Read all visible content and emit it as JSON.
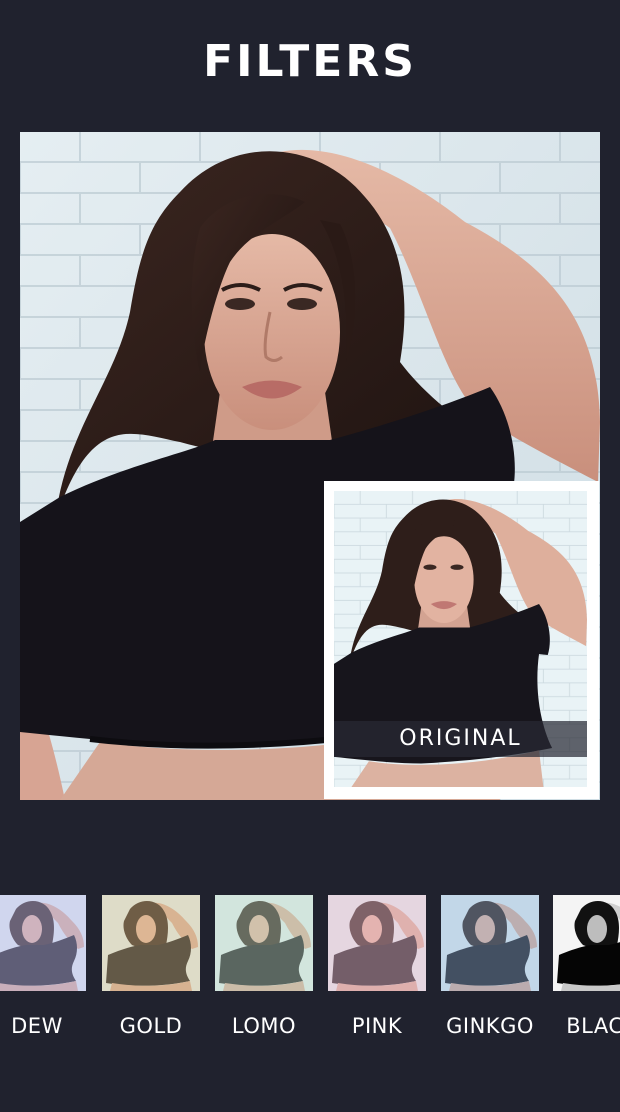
{
  "header": {
    "title": "FILTERS"
  },
  "preview": {
    "original_label": "ORIGINAL"
  },
  "filters": [
    {
      "label": "DEW",
      "tint": "#b9b7e8",
      "tint_opacity": 0.45
    },
    {
      "label": "GOLD",
      "tint": "#d8c08a",
      "tint_opacity": 0.4
    },
    {
      "label": "LOMO",
      "tint": "#b9d8c0",
      "tint_opacity": 0.42
    },
    {
      "label": "PINK",
      "tint": "#e7b8c9",
      "tint_opacity": 0.45
    },
    {
      "label": "GINKGO",
      "tint": "#8fb2d8",
      "tint_opacity": 0.38
    },
    {
      "label": "BLACK",
      "tint": "#000000",
      "tint_opacity": 0.0
    }
  ],
  "colors": {
    "background": "#20222e",
    "title_text": "#ffffff",
    "wall": "#dce8ec",
    "shirt": "#15131a"
  }
}
